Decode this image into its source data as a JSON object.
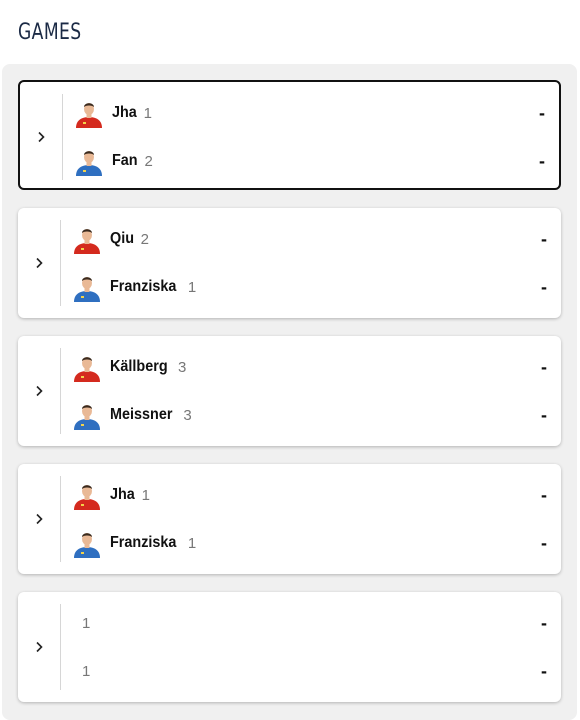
{
  "header": {
    "title": "GAMES"
  },
  "games": [
    {
      "selected": true,
      "players": [
        {
          "name": "Jha",
          "seed": "1",
          "score": "-",
          "jersey": "red"
        },
        {
          "name": "Fan",
          "seed": "2",
          "score": "-",
          "jersey": "blue"
        }
      ]
    },
    {
      "selected": false,
      "players": [
        {
          "name": "Qiu",
          "seed": "2",
          "score": "-",
          "jersey": "red"
        },
        {
          "name": "Franziska",
          "seed": "1",
          "score": "-",
          "jersey": "blue"
        }
      ]
    },
    {
      "selected": false,
      "players": [
        {
          "name": "Källberg",
          "seed": "3",
          "score": "-",
          "jersey": "red"
        },
        {
          "name": "Meissner",
          "seed": "3",
          "score": "-",
          "jersey": "blue"
        }
      ]
    },
    {
      "selected": false,
      "players": [
        {
          "name": "Jha",
          "seed": "1",
          "score": "-",
          "jersey": "red"
        },
        {
          "name": "Franziska",
          "seed": "1",
          "score": "-",
          "jersey": "blue"
        }
      ]
    },
    {
      "selected": false,
      "players": [
        {
          "name": "",
          "seed": "1",
          "score": "-",
          "jersey": ""
        },
        {
          "name": "",
          "seed": "1",
          "score": "-",
          "jersey": ""
        }
      ]
    }
  ],
  "icons": {
    "expand": "chevron-right-icon",
    "avatar": "player-avatar-icon"
  },
  "colors": {
    "red_jersey": "#d42a1e",
    "blue_jersey": "#2f6fc0",
    "title": "#1b2a45"
  }
}
